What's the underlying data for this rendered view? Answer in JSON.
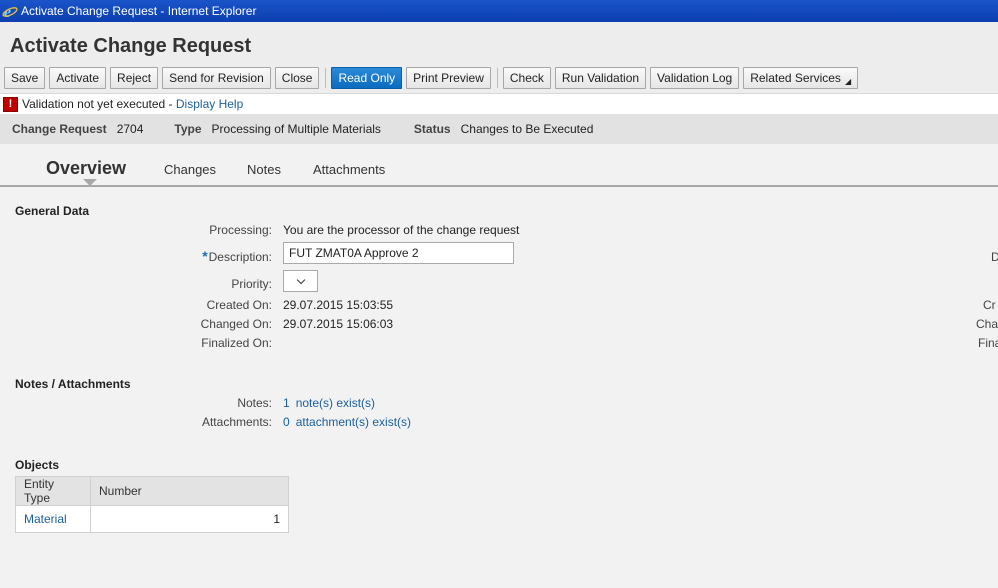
{
  "window": {
    "title": "Activate Change Request - Internet Explorer",
    "icon": "ie-icon"
  },
  "page": {
    "title": "Activate Change Request"
  },
  "toolbar": {
    "save": "Save",
    "activate": "Activate",
    "reject": "Reject",
    "send_for_revision": "Send for Revision",
    "close": "Close",
    "read_only": "Read Only",
    "print_preview": "Print Preview",
    "check": "Check",
    "run_validation": "Run Validation",
    "validation_log": "Validation Log",
    "related_services": "Related Services"
  },
  "message": {
    "text": "Validation not yet executed",
    "separator": " - ",
    "link": "Display Help",
    "icon": "error-icon"
  },
  "info": {
    "change_request_label": "Change Request",
    "change_request_value": "2704",
    "type_label": "Type",
    "type_value": "Processing of Multiple Materials",
    "status_label": "Status",
    "status_value": "Changes to Be Executed"
  },
  "tabs": {
    "overview": "Overview",
    "changes": "Changes",
    "notes": "Notes",
    "attachments": "Attachments"
  },
  "general": {
    "title": "General Data",
    "processing_label": "Processing:",
    "processing_value": "You are the processor of the change request",
    "description_label": "Description:",
    "description_value": "FUT ZMAT0A Approve 2",
    "priority_label": "Priority:",
    "priority_value": "",
    "created_label": "Created On:",
    "created_value": "29.07.2015 15:03:55",
    "changed_label": "Changed On:",
    "changed_value": "29.07.2015 15:06:03",
    "finalized_label": "Finalized On:",
    "finalized_value": "",
    "cut_labels": [
      "D",
      "Cr",
      "Cha",
      "Fina"
    ]
  },
  "notes_attachments": {
    "title": "Notes / Attachments",
    "notes_label": "Notes:",
    "notes_count": "1",
    "notes_link": "note(s) exist(s)",
    "attachments_label": "Attachments:",
    "attachments_count": "0",
    "attachments_link": "attachment(s) exist(s)"
  },
  "objects": {
    "title": "Objects",
    "columns": [
      "Entity Type",
      "Number"
    ],
    "rows": [
      {
        "entity_type": "Material",
        "number": "1"
      }
    ]
  }
}
